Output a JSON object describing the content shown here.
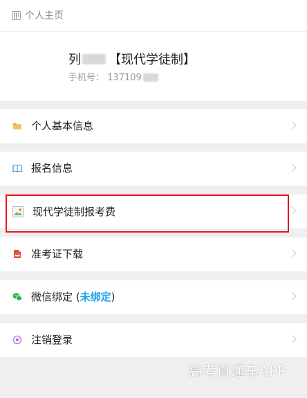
{
  "header": {
    "title": "个人主页",
    "icon": "grid-icon"
  },
  "profile": {
    "name_prefix": "列",
    "program_tag": "【现代学徒制】",
    "phone_label": "手机号：",
    "phone_value": "137109"
  },
  "menu": [
    {
      "label": "个人基本信息",
      "icon": "folder-icon"
    },
    {
      "label": "报名信息",
      "icon": "book-icon"
    },
    {
      "label": "现代学徒制报考费",
      "icon": "broken-image-icon"
    },
    {
      "label": "准考证下载",
      "icon": "pdf-icon"
    },
    {
      "label_prefix": "微信绑定 (",
      "label_status": "未绑定",
      "label_suffix": ")",
      "icon": "wechat-icon"
    },
    {
      "label": "注销登录",
      "icon": "logout-icon"
    }
  ],
  "watermark": "高考直通车APP",
  "colors": {
    "accent_blue": "#1aa3e8",
    "highlight_red": "#e8141b",
    "gap_gray": "#efefef"
  }
}
